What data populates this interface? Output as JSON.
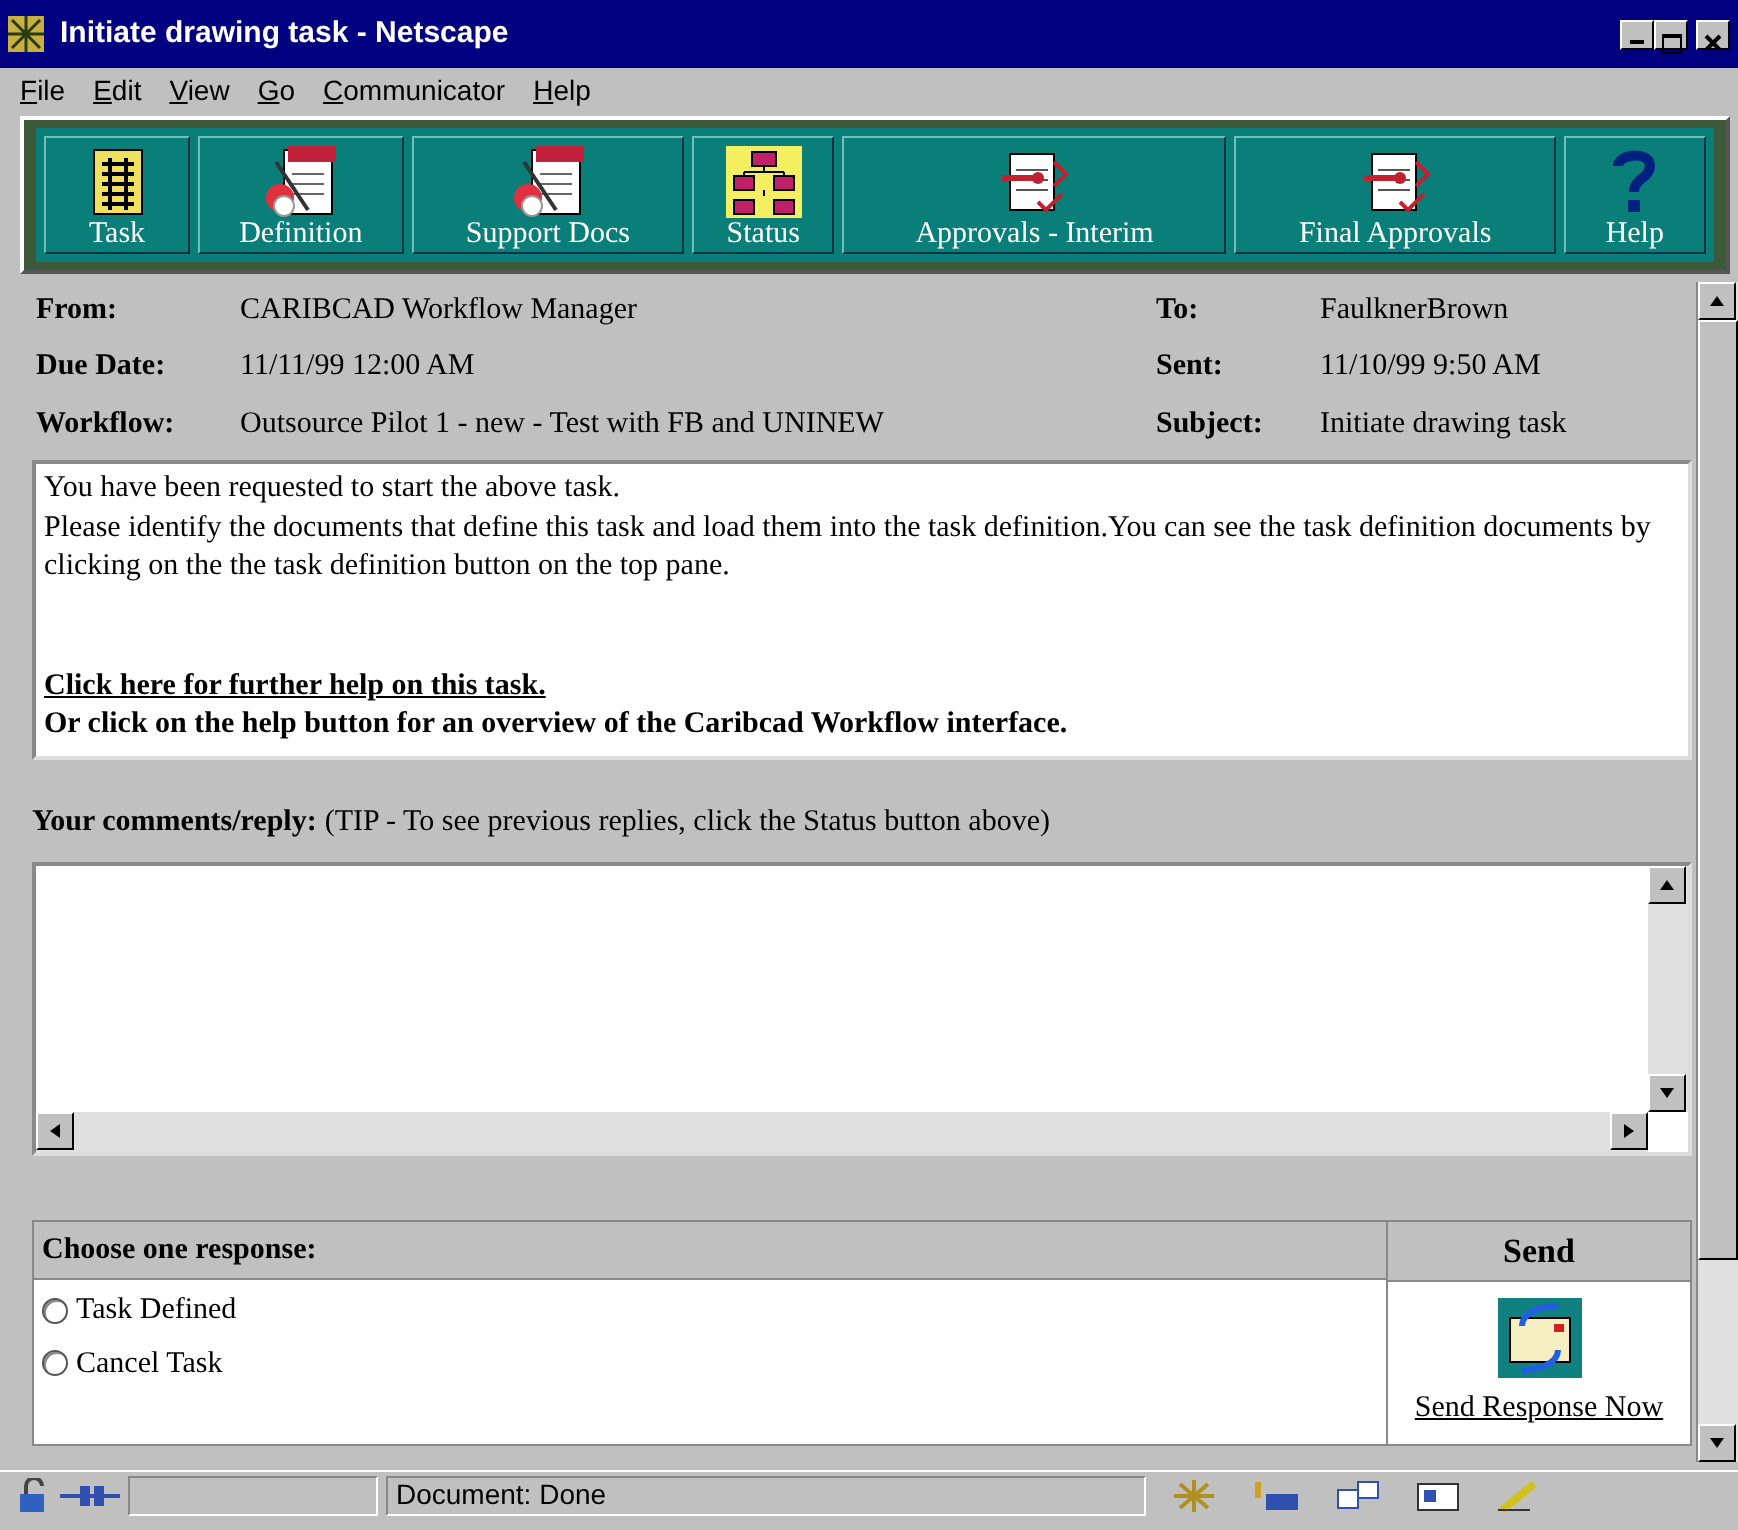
{
  "window": {
    "title": "Initiate drawing task - Netscape"
  },
  "menu": [
    "File",
    "Edit",
    "View",
    "Go",
    "Communicator",
    "Help"
  ],
  "toolbar": [
    {
      "label": "Task",
      "kind": "ledger"
    },
    {
      "label": "Definition",
      "kind": "notepad"
    },
    {
      "label": "Support Docs",
      "kind": "notepad"
    },
    {
      "label": "Status",
      "kind": "chart"
    },
    {
      "label": "Approvals - Interim",
      "kind": "approval"
    },
    {
      "label": "Final Approvals",
      "kind": "approval"
    },
    {
      "label": "Help",
      "kind": "help"
    }
  ],
  "header": {
    "left": [
      {
        "label": "From:",
        "value": "CARIBCAD Workflow Manager"
      },
      {
        "label": "Due Date:",
        "value": "11/11/99 12:00 AM"
      },
      {
        "label": "Workflow:",
        "value": "Outsource Pilot 1 - new - Test with FB and UNINEW"
      }
    ],
    "right": [
      {
        "label": "To:",
        "value": "FaulknerBrown"
      },
      {
        "label": "Sent:",
        "value": "11/10/99 9:50 AM"
      },
      {
        "label": "Subject:",
        "value": "Initiate drawing task"
      }
    ]
  },
  "message": {
    "lines": [
      "You have been requested to start the above task.",
      "Please identify the documents that define this task and load them into the task definition.You can see the task definition documents by clicking on the the task definition button on the top pane."
    ],
    "help_link": "Click here for further help on this task.",
    "help_note": "Or click on the help button for an overview of the Caribcad Workflow interface."
  },
  "comments": {
    "label": "Your comments/reply:",
    "tip": "(TIP - To see previous replies, click the Status button above)"
  },
  "response": {
    "heading": "Choose one response:",
    "options": [
      {
        "label": "Task Defined",
        "selected": false
      },
      {
        "label": "Cancel Task",
        "selected": false
      }
    ],
    "send_heading": "Send",
    "send_link": "Send Response Now"
  },
  "status_bar": {
    "text": "Document: Done"
  }
}
